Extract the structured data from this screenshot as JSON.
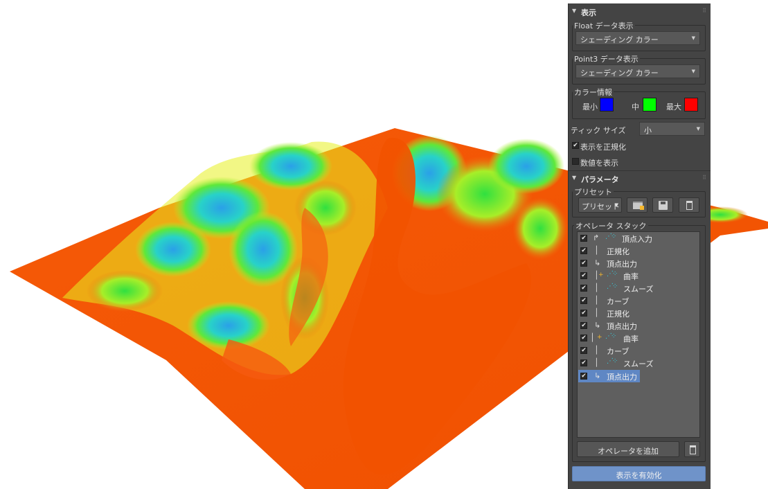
{
  "display": {
    "title": "表示",
    "float_group": {
      "label": "Float データ表示",
      "selected": "シェーディング カラー"
    },
    "point3_group": {
      "label": "Point3 データ表示",
      "selected": "シェーディング カラー"
    },
    "color_group": {
      "label": "カラー情報",
      "min_label": "最小",
      "min_color": "#0000ff",
      "mid_label": "中",
      "mid_color": "#00ff00",
      "max_label": "最大",
      "max_color": "#ff0000"
    },
    "tick_size": {
      "label": "ティック サイズ",
      "selected": "小"
    },
    "normalize": {
      "label": "表示を正規化",
      "checked": true
    },
    "show_values": {
      "label": "数値を表示",
      "checked": false
    }
  },
  "parameters": {
    "title": "パラメータ",
    "preset_group": {
      "label": "プリセット",
      "dropdown_label": "プリセット"
    },
    "stack_group": {
      "label": "オペレータ スタック"
    },
    "operators": [
      {
        "label": "頂点入力",
        "checked": true
      },
      {
        "label": "正規化",
        "checked": true
      },
      {
        "label": "頂点出力",
        "checked": true
      },
      {
        "label": "曲率",
        "checked": true
      },
      {
        "label": "スムーズ",
        "checked": true
      },
      {
        "label": "カーブ",
        "checked": true
      },
      {
        "label": "正規化",
        "checked": true
      },
      {
        "label": "頂点出力",
        "checked": true
      },
      {
        "label": "曲率",
        "checked": true
      },
      {
        "label": "カーブ",
        "checked": true
      },
      {
        "label": "スムーズ",
        "checked": true
      },
      {
        "label": "頂点出力",
        "checked": true,
        "selected": true
      }
    ],
    "add_operator_label": "オペレータを追加",
    "enable_display_label": "表示を有効化"
  },
  "terrain_colors": {
    "base": "#f25200",
    "green": "#3ee83a",
    "yellow": "#c8f020",
    "cyan": "#1ec8d8",
    "blue": "#2a70e0"
  }
}
